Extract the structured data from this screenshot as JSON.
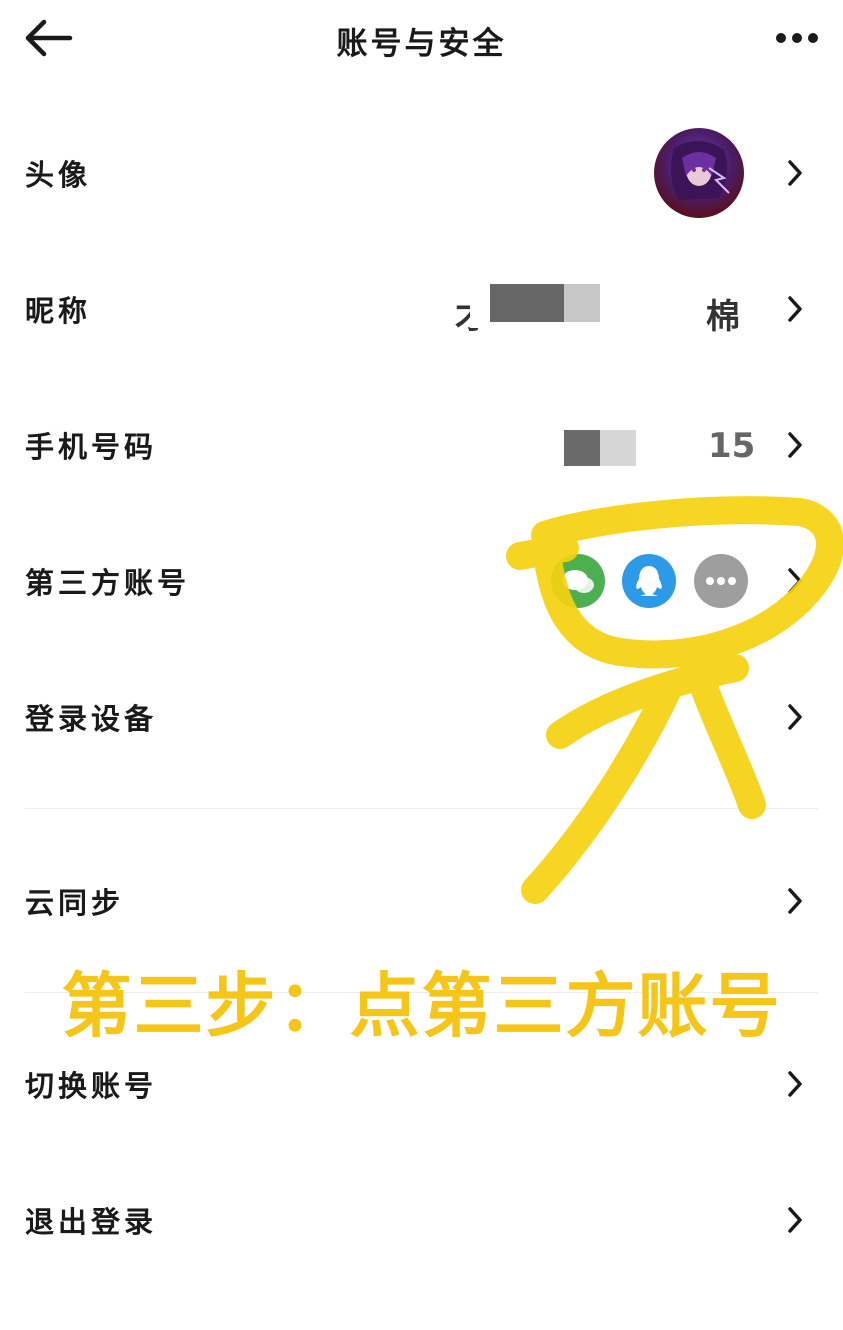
{
  "header": {
    "title": "账号与安全",
    "back_icon": "back-arrow-icon",
    "more_icon": "more-dots-icon"
  },
  "rows": [
    {
      "label": "头像"
    },
    {
      "label": "昵称",
      "value_visible_start": "才",
      "value_visible_end": "棉"
    },
    {
      "label": "手机号码",
      "value_visible_end": "15"
    },
    {
      "label": "第三方账号",
      "icons": [
        "wechat-icon",
        "qq-icon",
        "more-icon"
      ]
    },
    {
      "label": "登录设备"
    },
    {
      "label": "云同步"
    },
    {
      "label": "切换账号"
    },
    {
      "label": "退出登录"
    }
  ],
  "annotation": {
    "caption": "第三步：点第三方账号",
    "color": "#f5c518"
  },
  "colors": {
    "wechat": "#4caf50",
    "qq": "#2d9ae8",
    "more": "#9e9e9e",
    "caption": "#f5c518"
  }
}
